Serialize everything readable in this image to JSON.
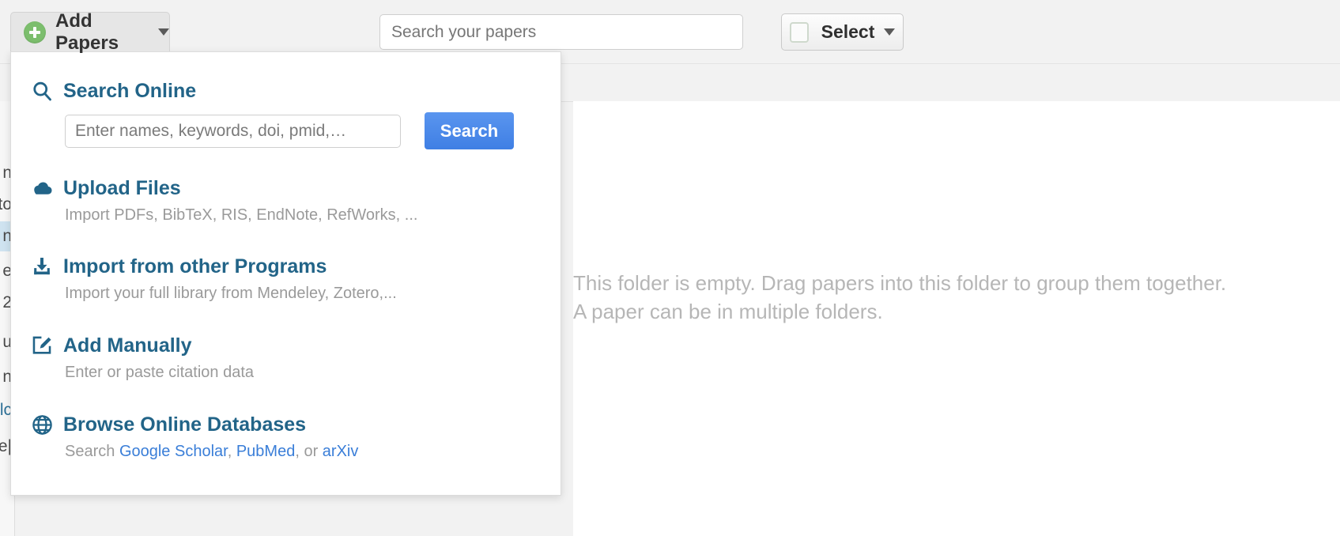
{
  "toolbar": {
    "add_papers_label": "Add Papers",
    "add_papers_icon": "plus-circle-icon",
    "caret_icon": "chevron-down-icon",
    "search_placeholder": "Search your papers",
    "search_value": "",
    "select_label": "Select",
    "select_checkbox_icon": "checkbox-unchecked-icon",
    "select_caret_icon": "chevron-down-icon"
  },
  "sidebar": {
    "rows": [
      {
        "text": "n",
        "state": "normal"
      },
      {
        "text": "to",
        "state": "normal"
      },
      {
        "text": "n",
        "state": "active"
      },
      {
        "text": "e",
        "state": "normal"
      },
      {
        "text": "2",
        "state": "normal"
      },
      {
        "text": "",
        "state": "normal"
      },
      {
        "text": "u",
        "state": "normal"
      },
      {
        "text": "n",
        "state": "normal"
      },
      {
        "text": "lc",
        "state": "normal"
      },
      {
        "text": "e|",
        "state": "normal"
      }
    ]
  },
  "dropdown": {
    "items": [
      {
        "id": "search-online",
        "icon": "magnifier-icon",
        "title": "Search Online",
        "input_placeholder": "Enter names, keywords, doi, pmid,…",
        "input_value": "",
        "button_label": "Search"
      },
      {
        "id": "upload-files",
        "icon": "cloud-upload-icon",
        "title": "Upload Files",
        "subtitle": "Import PDFs, BibTeX, RIS, EndNote, RefWorks, ..."
      },
      {
        "id": "import-other-programs",
        "icon": "download-tray-icon",
        "title": "Import from other Programs",
        "subtitle": "Import your full library from Mendeley, Zotero,..."
      },
      {
        "id": "add-manually",
        "icon": "pencil-square-icon",
        "title": "Add Manually",
        "subtitle": "Enter or paste citation data"
      },
      {
        "id": "browse-online-databases",
        "icon": "globe-icon",
        "title": "Browse Online Databases",
        "subtitle_prefix": "Search ",
        "link_1": "Google Scholar",
        "sep_1": ", ",
        "link_2": "PubMed",
        "sep_2": ", or ",
        "link_3": "arXiv"
      }
    ]
  },
  "main": {
    "empty_line_1": "This folder is empty. Drag papers into this folder to group them together.",
    "empty_line_2": "A paper can be in multiple folders."
  },
  "colors": {
    "accent_blue": "#226488",
    "link_blue": "#3a7ed8",
    "button_blue": "#4285ef",
    "add_green": "#7cbe6d",
    "muted_gray": "#9a9a9a",
    "empty_gray": "#b6b6b6",
    "toolbar_bg": "#f2f2f2"
  }
}
